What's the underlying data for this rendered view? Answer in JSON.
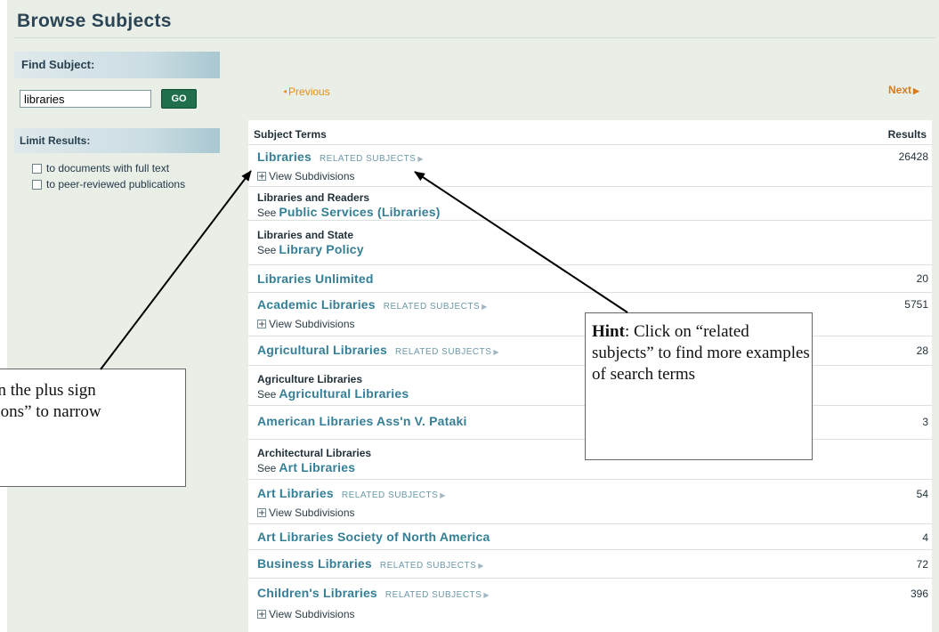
{
  "page": {
    "title": "Browse Subjects"
  },
  "sidebar": {
    "find_heading": "Find Subject:",
    "search_value": "libraries",
    "go_label": "GO",
    "limit_heading": "Limit Results:",
    "limits": [
      {
        "label": "to documents with full text",
        "checked": false
      },
      {
        "label": "to peer-reviewed publications",
        "checked": false
      }
    ]
  },
  "pager": {
    "previous": "Previous",
    "next": "Next"
  },
  "table": {
    "col_terms": "Subject Terms",
    "col_results": "Results",
    "related_label": "RELATED SUBJECTS",
    "view_subdivisions_label": "View Subdivisions",
    "see_prefix": "See",
    "rows": [
      {
        "term": "Libraries",
        "related": true,
        "count": "26428",
        "subdivisions": true
      },
      {
        "heading": "Libraries and Readers",
        "see": "Public Services (Libraries)"
      },
      {
        "heading": "Libraries and State",
        "see": "Library Policy"
      },
      {
        "term": "Libraries Unlimited",
        "related": false,
        "count": "20",
        "subdivisions": false
      },
      {
        "term": "Academic Libraries",
        "related": true,
        "count": "5751",
        "subdivisions": true
      },
      {
        "term": "Agricultural Libraries",
        "related": true,
        "count": "28",
        "subdivisions": false
      },
      {
        "heading": "Agriculture Libraries",
        "see": "Agricultural Libraries"
      },
      {
        "term": "American Libraries Ass'n V. Pataki",
        "related": false,
        "count": "3",
        "subdivisions": false
      },
      {
        "heading": "Architectural Libraries",
        "see": "Art Libraries"
      },
      {
        "term": "Art Libraries",
        "related": true,
        "count": "54",
        "subdivisions": true
      },
      {
        "term": "Art Libraries Society of North America",
        "related": false,
        "count": "4",
        "subdivisions": false
      },
      {
        "term": "Business Libraries",
        "related": true,
        "count": "72",
        "subdivisions": false
      },
      {
        "term": "Children's Libraries",
        "related": true,
        "count": "396",
        "subdivisions": true
      }
    ]
  },
  "callouts": {
    "left_line1": "on the plus sign",
    "left_line2": "sions” to narrow",
    "right_hint_label": "Hint",
    "right_text": ": Click on “related subjects” to find more examples of search terms"
  },
  "colors": {
    "link": "#357f96",
    "accent_orange": "#e0901a",
    "go_button": "#1f6e4c",
    "background": "#e9efe6"
  }
}
